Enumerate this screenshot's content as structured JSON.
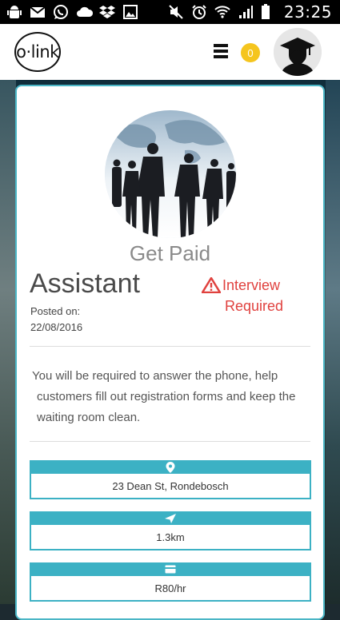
{
  "status_bar": {
    "time": "23:25",
    "left_icons": [
      "android-debug-icon",
      "gmail-icon",
      "whatsapp-icon",
      "cloud-icon",
      "dropbox-icon",
      "gallery-icon"
    ],
    "right_icons": [
      "mute-icon",
      "alarm-icon",
      "wifi-icon",
      "signal-icon",
      "battery-icon"
    ]
  },
  "header": {
    "logo": "o·link",
    "notification_count": "0"
  },
  "job": {
    "category": "Get Paid",
    "title": "Assistant",
    "warning_line1": "Interview",
    "warning_line2": "Required",
    "posted_label": "Posted on:",
    "posted_date": "22/08/2016",
    "description_line1": "You will be required to answer the phone, help",
    "description_line2": "customers fill out registration forms and keep the",
    "description_line3": "waiting room clean.",
    "location": "23 Dean St, Rondebosch",
    "distance": "1.3km",
    "rate": "R80/hr"
  },
  "colors": {
    "accent": "#3cb1c4",
    "warning": "#e0413e",
    "badge": "#f5c51e"
  }
}
